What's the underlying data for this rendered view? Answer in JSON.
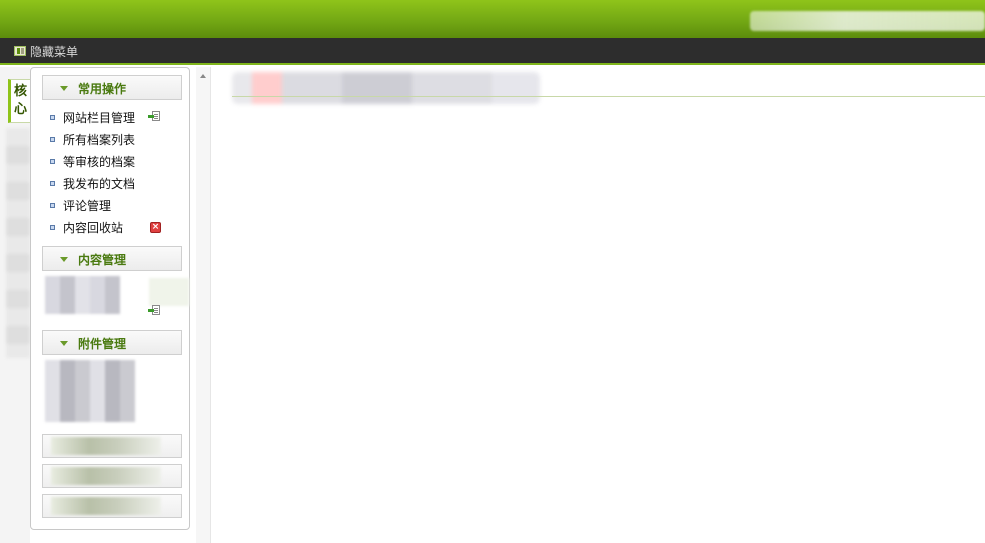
{
  "menubar": {
    "hide_menu_label": "隐藏菜单"
  },
  "left_strip": {
    "tab_core_label": "核心"
  },
  "sections": [
    {
      "title": "常用操作",
      "items": [
        {
          "label": "网站栏目管理",
          "action_icon": "add-icon"
        },
        {
          "label": "所有档案列表"
        },
        {
          "label": "等审核的档案"
        },
        {
          "label": "我发布的文档"
        },
        {
          "label": "评论管理"
        },
        {
          "label": "内容回收站",
          "action_icon": "delete-icon"
        }
      ]
    },
    {
      "title": "内容管理"
    },
    {
      "title": "附件管理"
    }
  ],
  "colors": {
    "topbar": "#73a814",
    "menubar": "#2d2d2d",
    "accent": "#8fc41a",
    "section_title": "#4a7a10"
  }
}
